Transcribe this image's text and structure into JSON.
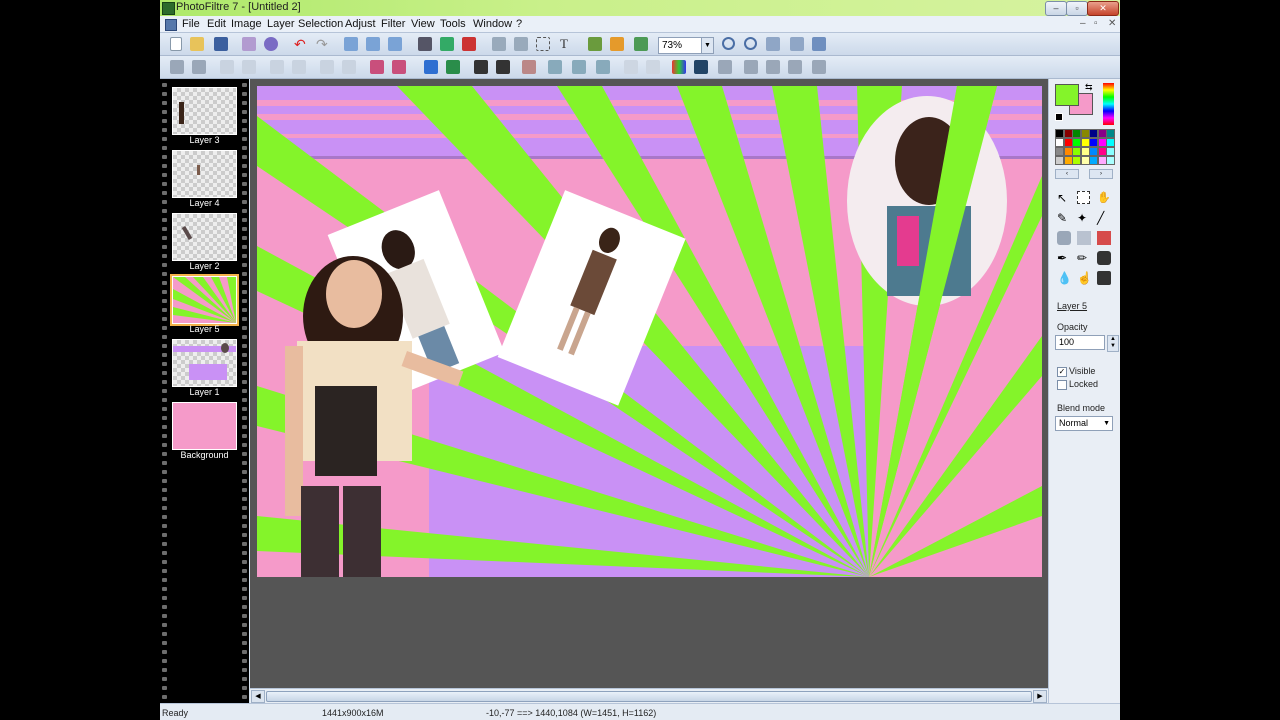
{
  "window": {
    "title": "PhotoFiltre 7 - [Untitled 2]",
    "controls": {
      "minimize": "–",
      "maximize": "▫",
      "close": "✕"
    }
  },
  "menu": [
    "File",
    "Edit",
    "Image",
    "Layer",
    "Selection",
    "Adjust",
    "Filter",
    "View",
    "Tools",
    "Window",
    "?"
  ],
  "mdi_controls": {
    "minimize": "–",
    "restore": "▫",
    "close": "✕"
  },
  "toolbar": {
    "zoom": "73%"
  },
  "layers": [
    {
      "name": "Layer 3",
      "selected": false
    },
    {
      "name": "Layer 4",
      "selected": false
    },
    {
      "name": "Layer 2",
      "selected": false
    },
    {
      "name": "Layer 5",
      "selected": true
    },
    {
      "name": "Layer 1",
      "selected": false
    },
    {
      "name": "Background",
      "selected": false
    }
  ],
  "properties": {
    "layer_name": "Layer 5",
    "opacity_label": "Opacity",
    "opacity_value": "100",
    "visible_label": "Visible",
    "visible_checked": true,
    "locked_label": "Locked",
    "locked_checked": false,
    "blend_label": "Blend mode",
    "blend_value": "Normal"
  },
  "colors": {
    "foreground": "#84f42a",
    "background": "#f59ac9"
  },
  "status": {
    "state": "Ready",
    "image_size": "1441x900x16M",
    "coords": "-10,-77 ==> 1440,1084 (W=1451, H=1162)"
  }
}
